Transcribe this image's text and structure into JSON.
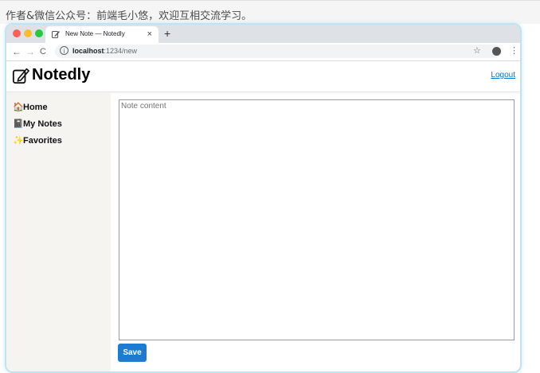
{
  "caption": "作者&微信公众号：前端毛小悠，欢迎互相交流学习。",
  "browser": {
    "tab_title": "New Note — Notedly",
    "tab_close": "×",
    "new_tab": "+",
    "url_host": "localhost",
    "url_path": ":1234/new",
    "back": "←",
    "forward": "→",
    "reload": "C",
    "info": "i",
    "bookmark": "☆",
    "menu": "⋮"
  },
  "app": {
    "logo": "Notedly",
    "logout": "Logout",
    "nav": [
      {
        "label": "Home",
        "icon": "house-icon"
      },
      {
        "label": "My Notes",
        "icon": "notebook-icon"
      },
      {
        "label": "Favorites",
        "icon": "star-glowing-icon"
      }
    ],
    "editor": {
      "placeholder": "Note content",
      "value": ""
    },
    "save_label": "Save"
  },
  "colors": {
    "accent": "#1d7bd2",
    "link": "#0077cc",
    "sidebar_bg": "#f5f4f0",
    "window_glow": "#bfe3f2"
  }
}
